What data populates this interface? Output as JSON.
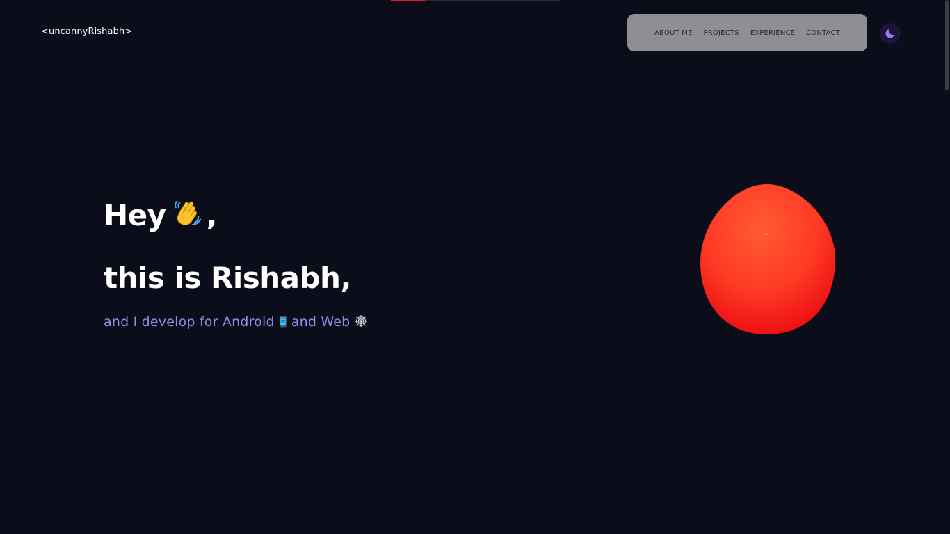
{
  "header": {
    "logo": "<uncannyRishabh>",
    "nav": [
      "ABOUT ME",
      "PROJECTS",
      "EXPERIENCE",
      "CONTACT"
    ],
    "theme_toggle_icon": "moon-icon"
  },
  "scroll_progress": 0.2,
  "hero": {
    "greeting": "Hey",
    "greeting_icon": "waving-hand-icon",
    "greeting_comma": ",",
    "intro": "this is Rishabh,",
    "sub_prefix": "and I develop for Android",
    "sub_icon_1": "mobile-phone-icon",
    "sub_middle": "and Web",
    "sub_icon_2": "spider-web-icon"
  },
  "colors": {
    "background": "#0b0d1a",
    "accent": "#8b8fe6",
    "blob": "#ff3b2a",
    "progress": "#e11d2a"
  }
}
